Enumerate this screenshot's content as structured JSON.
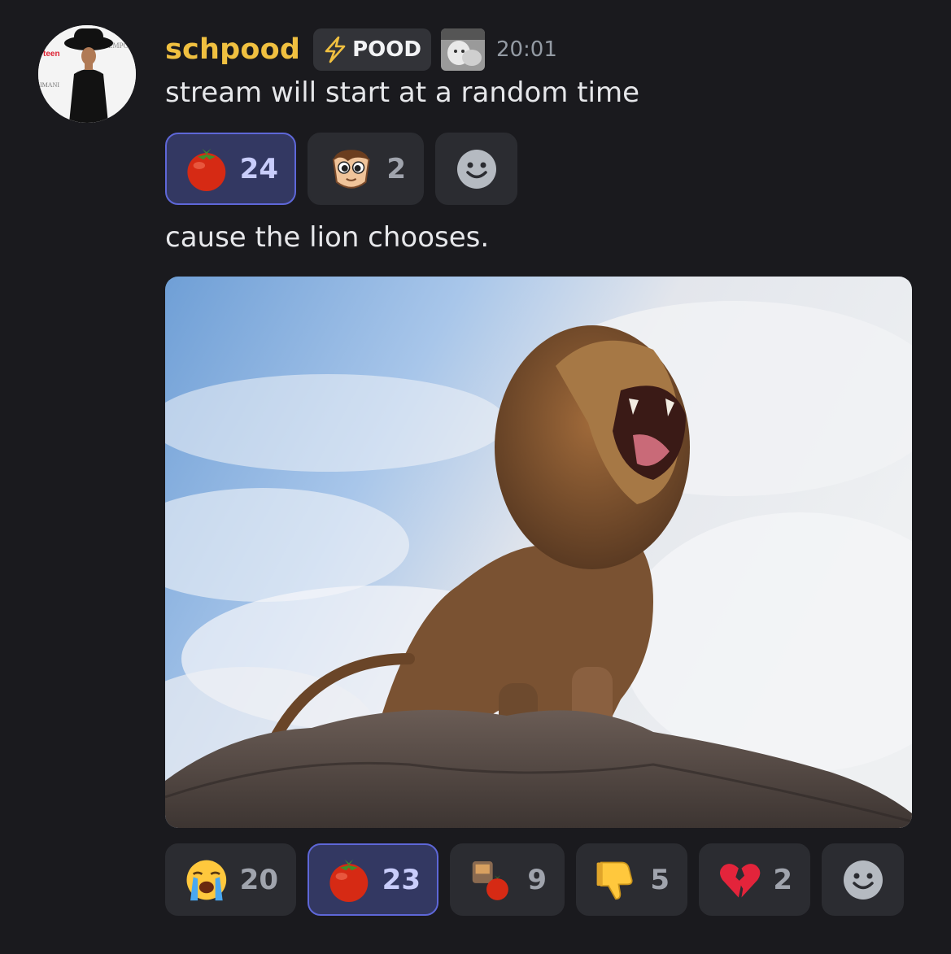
{
  "message": {
    "author": "schpood",
    "role_label": "POOD",
    "timestamp": "20:01",
    "lines": [
      "stream will start at a random time",
      "cause the lion chooses."
    ]
  },
  "reactions_first": [
    {
      "emoji": "tomato-icon",
      "count": "24",
      "active": true
    },
    {
      "emoji": "cartoon-face-icon",
      "count": "2",
      "active": false
    }
  ],
  "reactions_second": [
    {
      "emoji": "loudly-crying-face-icon",
      "count": "20",
      "active": false
    },
    {
      "emoji": "tomato-icon",
      "count": "23",
      "active": true
    },
    {
      "emoji": "custom-tomato-sticker-icon",
      "count": "9",
      "active": false
    },
    {
      "emoji": "thumbs-down-icon",
      "count": "5",
      "active": false
    },
    {
      "emoji": "broken-heart-icon",
      "count": "2",
      "active": false
    }
  ],
  "colors": {
    "background": "#1a1a1e",
    "username": "#f0c040",
    "active_reaction_border": "#5e67d8",
    "reaction_bg": "#2b2c31"
  }
}
